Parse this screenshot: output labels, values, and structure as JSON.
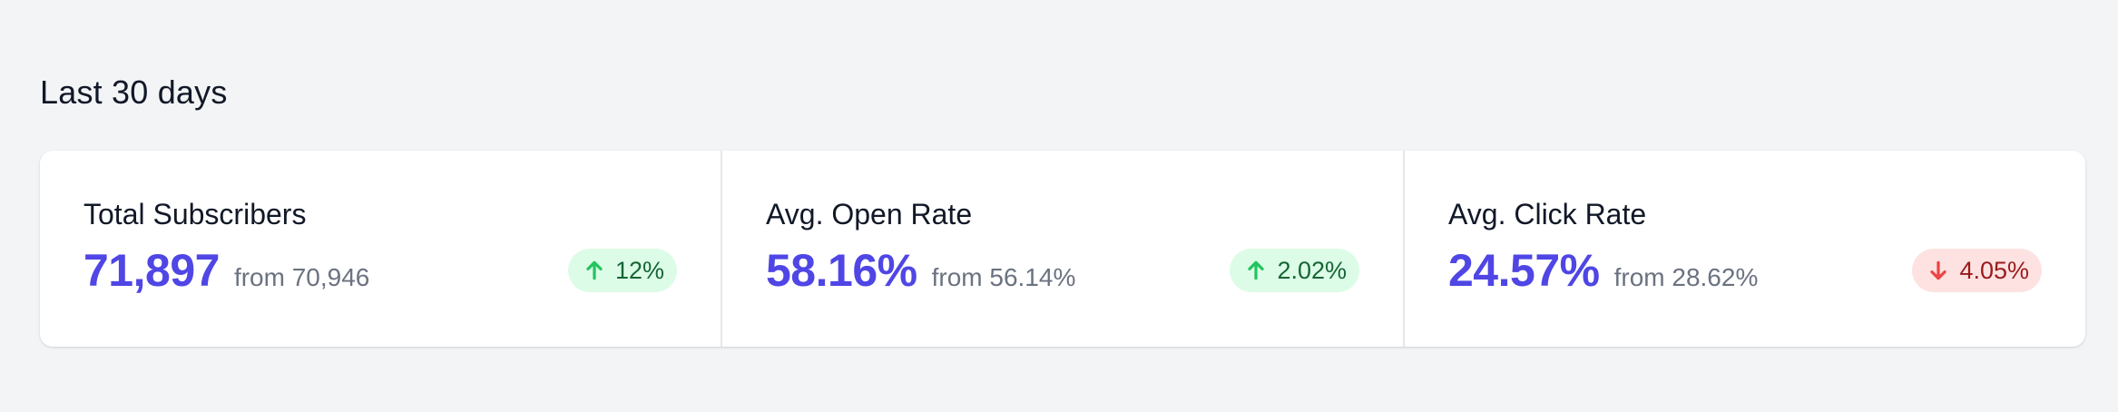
{
  "section": {
    "title": "Last 30 days"
  },
  "stats": [
    {
      "label": "Total Subscribers",
      "value": "71,897",
      "previous": "from 70,946",
      "change": "12%",
      "trend": "up",
      "icon": "arrow-up-icon"
    },
    {
      "label": "Avg. Open Rate",
      "value": "58.16%",
      "previous": "from 56.14%",
      "change": "2.02%",
      "trend": "up",
      "icon": "arrow-up-icon"
    },
    {
      "label": "Avg. Click Rate",
      "value": "24.57%",
      "previous": "from 28.62%",
      "change": "4.05%",
      "trend": "down",
      "icon": "arrow-down-icon"
    }
  ],
  "colors": {
    "accent": "#4f46e5",
    "increase_bg": "#dcfce7",
    "increase_text": "#166534",
    "decrease_bg": "#fee2e2",
    "decrease_text": "#991b1b",
    "background": "#f3f4f6"
  }
}
